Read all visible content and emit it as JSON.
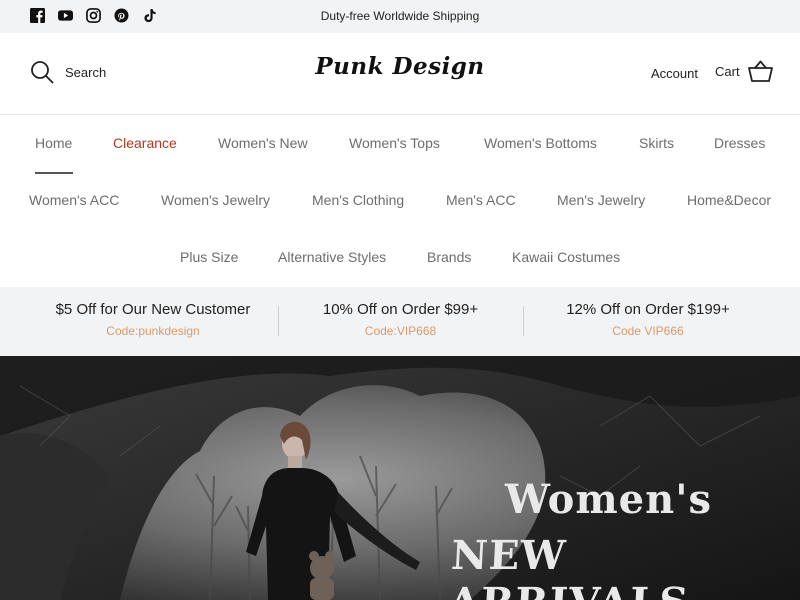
{
  "topbar": {
    "announcement": "Duty-free Worldwide Shipping",
    "social_icons": [
      "facebook-icon",
      "youtube-icon",
      "instagram-icon",
      "pinterest-icon",
      "tiktok-icon"
    ]
  },
  "header": {
    "search_label": "Search",
    "logo_text": "Punk Design",
    "account_label": "Account",
    "cart_label": "Cart"
  },
  "nav": {
    "active": "Home",
    "items": [
      "Home",
      "Clearance",
      "Women's New",
      "Women's Tops",
      "Women's Bottoms",
      "Skirts",
      "Dresses",
      "Women's ACC",
      "Women's Jewelry",
      "Men's Clothing",
      "Men's ACC",
      "Men's Jewelry",
      "Home&Decor",
      "Plus Size",
      "Alternative Styles",
      "Brands",
      "Kawaii Costumes"
    ]
  },
  "promos": [
    {
      "title": "$5 Off for Our New Customer",
      "code": "Code:punkdesign"
    },
    {
      "title": "10% Off on Order $99+",
      "code": "Code:VIP668"
    },
    {
      "title": "12% Off on Order $199+",
      "code": "Code VIP666"
    }
  ],
  "hero": {
    "line1": "Women's",
    "line2": "NEW ARRIVALS"
  },
  "colors": {
    "accent_red": "#b3371e",
    "promo_code": "#d99a6c",
    "bar_bg": "#f2f3f4"
  }
}
